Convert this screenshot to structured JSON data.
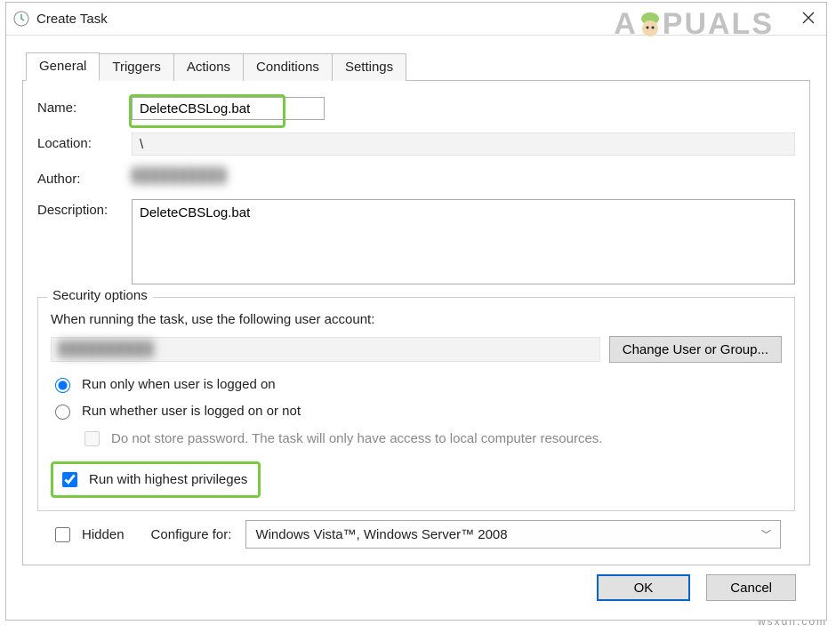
{
  "watermark": "A  PUALS",
  "site_credit": "wsxdn.com",
  "window": {
    "title": "Create Task",
    "close_label": "Close"
  },
  "tabs": [
    "General",
    "Triggers",
    "Actions",
    "Conditions",
    "Settings"
  ],
  "active_tab": 0,
  "general": {
    "name_label": "Name:",
    "name_value": "DeleteCBSLog.bat",
    "location_label": "Location:",
    "location_value": "\\",
    "author_label": "Author:",
    "author_value": "██████████",
    "description_label": "Description:",
    "description_value": "DeleteCBSLog.bat"
  },
  "security": {
    "legend": "Security options",
    "prompt": "When running the task, use the following user account:",
    "account_value": "██████████",
    "change_button": "Change User or Group...",
    "radio_logged_on": "Run only when user is logged on",
    "radio_logged_on_or_not": "Run whether user is logged on or not",
    "store_password": "Do not store password.  The task will only have access to local computer resources.",
    "highest_privileges": "Run with highest privileges",
    "radio_selected": "logged_on",
    "store_password_checked": false,
    "highest_privileges_checked": true
  },
  "bottom": {
    "hidden_label": "Hidden",
    "hidden_checked": false,
    "configure_label": "Configure for:",
    "configure_value": "Windows Vista™, Windows Server™ 2008"
  },
  "buttons": {
    "ok": "OK",
    "cancel": "Cancel"
  }
}
